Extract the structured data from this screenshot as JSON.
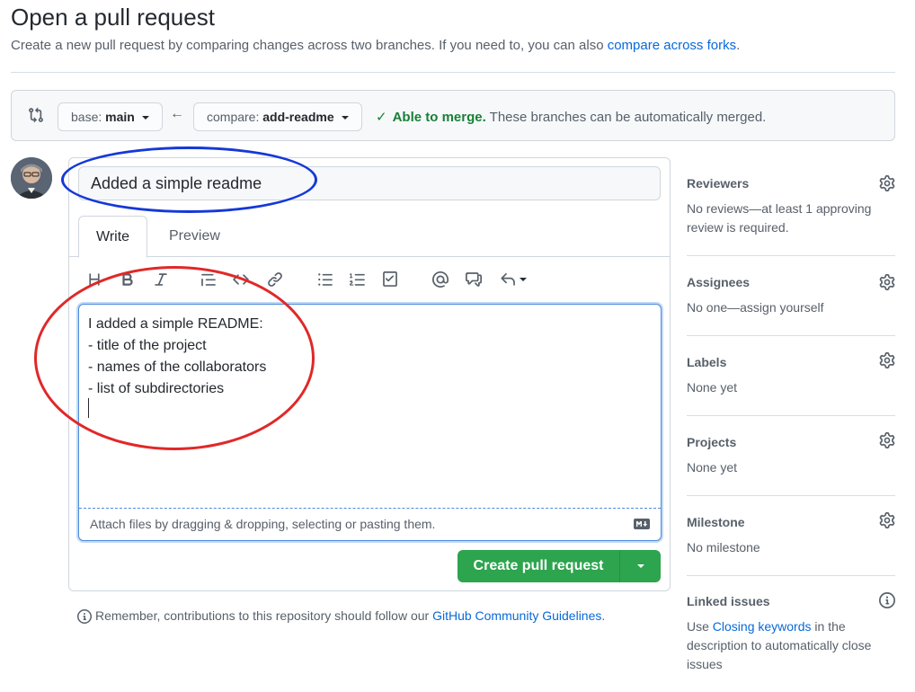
{
  "header": {
    "title": "Open a pull request",
    "subtitle_text": "Create a new pull request by comparing changes across two branches. If you need to, you can also ",
    "subtitle_link": "compare across forks",
    "subtitle_end": "."
  },
  "range": {
    "base_label": "base:",
    "base_branch": "main",
    "arrow": "←",
    "compare_label": "compare:",
    "compare_branch": "add-readme",
    "merge_status": "Able to merge.",
    "merge_detail": "These branches can be automatically merged."
  },
  "editor": {
    "title_value": "Added a simple readme",
    "tabs": [
      {
        "label": "Write"
      },
      {
        "label": "Preview"
      }
    ],
    "body_lines": [
      "I added a simple README:",
      "- title of the project",
      "- names of the collaborators",
      "- list of subdirectories"
    ],
    "attach_hint": "Attach files by dragging & dropping, selecting or pasting them.",
    "submit_label": "Create pull request"
  },
  "guidelines": {
    "text": "Remember, contributions to this repository should follow our ",
    "link": "GitHub Community Guidelines",
    "end": "."
  },
  "sidebar": {
    "reviewers": {
      "title": "Reviewers",
      "body": "No reviews—at least 1 approving review is required."
    },
    "assignees": {
      "title": "Assignees",
      "body": "No one—assign yourself"
    },
    "labels": {
      "title": "Labels",
      "body": "None yet"
    },
    "projects": {
      "title": "Projects",
      "body": "None yet"
    },
    "milestone": {
      "title": "Milestone",
      "body": "No milestone"
    },
    "linked": {
      "title": "Linked issues",
      "body_pre": "Use ",
      "body_link": "Closing keywords",
      "body_post": " in the description to automatically close issues"
    }
  },
  "colors": {
    "accent_link": "#0969da",
    "success": "#2da44e",
    "annotation_blue": "#1438d8",
    "annotation_red": "#e02828"
  },
  "icons": [
    "git-compare-icon",
    "arrow-left-icon",
    "check-icon",
    "gear-icon",
    "info-icon",
    "markdown-icon",
    "caret-down-icon"
  ]
}
